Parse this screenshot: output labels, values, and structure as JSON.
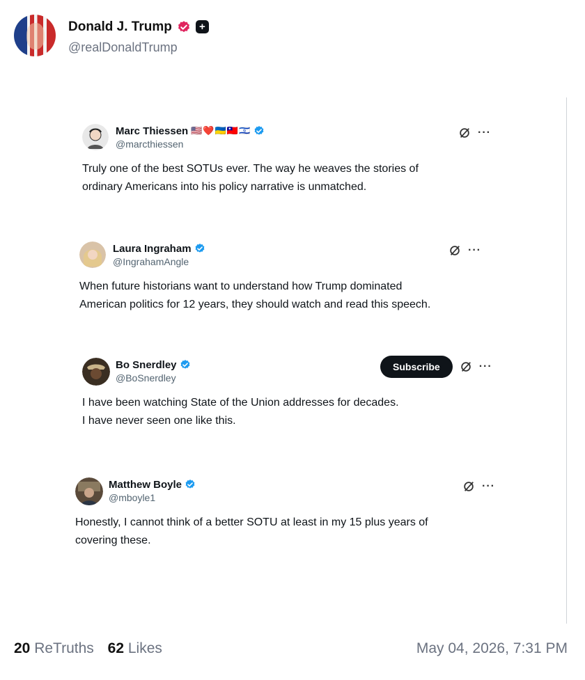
{
  "post": {
    "author_name": "Donald J. Trump",
    "author_handle": "@realDonaldTrump"
  },
  "tweets": [
    {
      "name": "Marc Thiessen",
      "handle": "@marcthiessen",
      "flags": "🇺🇸❤️🇺🇦🇹🇼🇮🇱",
      "text": "Truly one of the best SOTUs ever. The way he weaves the stories of\nordinary Americans into his policy narrative is unmatched."
    },
    {
      "name": "Laura Ingraham",
      "handle": "@IngrahamAngle",
      "text": "When future historians want to understand how Trump dominated\nAmerican politics for 12 years, they should watch and read this speech."
    },
    {
      "name": "Bo Snerdley",
      "handle": "@BoSnerdley",
      "subscribe_label": "Subscribe",
      "text": "I have been watching State of the Union addresses for decades.\nI have never seen one like this."
    },
    {
      "name": "Matthew Boyle",
      "handle": "@mboyle1",
      "text": "Honestly, I cannot think of a better SOTU at least in my 15 plus years of\ncovering these."
    }
  ],
  "footer": {
    "retruths_count": "20",
    "retruths_label": "ReTruths",
    "likes_count": "62",
    "likes_label": "Likes",
    "timestamp": "May 04, 2026, 7:31 PM"
  },
  "colors": {
    "verified_blue": "#1d9bf0",
    "verified_pink": "#e0245e",
    "text_primary": "#0f1419",
    "text_secondary": "#536471"
  }
}
